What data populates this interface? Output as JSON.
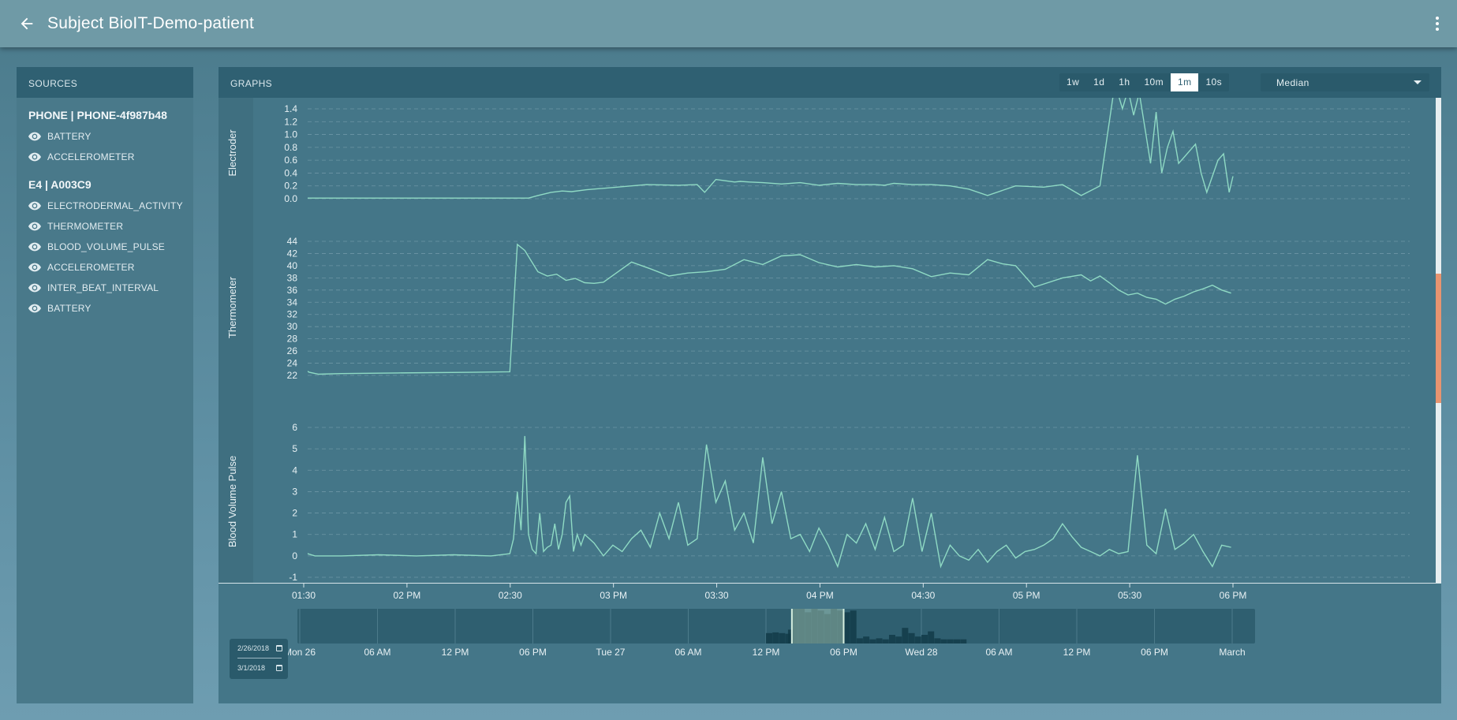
{
  "header": {
    "title": "Subject BioIT-Demo-patient",
    "back_icon": "arrow-left-icon",
    "menu_icon": "more-vertical-icon"
  },
  "sources": {
    "title": "SOURCES",
    "devices": [
      {
        "name": "PHONE | PHONE-4f987b48",
        "items": [
          "BATTERY",
          "ACCELEROMETER"
        ]
      },
      {
        "name": "E4 | A003C9",
        "items": [
          "ELECTRODERMAL_ACTIVITY",
          "THERMOMETER",
          "BLOOD_VOLUME_PULSE",
          "ACCELEROMETER",
          "INTER_BEAT_INTERVAL",
          "BATTERY"
        ]
      }
    ],
    "item_icon": "eye-icon"
  },
  "graphs": {
    "title": "GRAPHS",
    "ranges": [
      "1w",
      "1d",
      "1h",
      "10m",
      "1m",
      "10s"
    ],
    "active_range": "1m",
    "aggregation": "Median",
    "date_start": "2/26/2018",
    "date_end": "3/1/2018"
  },
  "colors": {
    "line": "#8fdac4",
    "scroll_thumb": "#e89470",
    "panel_header": "#2f6072"
  },
  "chart_data": [
    {
      "type": "line",
      "ylabel": "Electroder",
      "yticks": [
        0.0,
        0.2,
        0.4,
        0.6,
        0.8,
        1.0,
        1.2,
        1.4
      ],
      "ylim": [
        0.0,
        1.4
      ],
      "x_unit": "minutes since 01:30",
      "series": [
        {
          "x": [
            0,
            20,
            40,
            60,
            80,
            100,
            120,
            125,
            132,
            138,
            143,
            151,
            183,
            200,
            210,
            214,
            220,
            225,
            230,
            233,
            238,
            245,
            255,
            265,
            275,
            285,
            295,
            305,
            310,
            315,
            325,
            335,
            345,
            355,
            365,
            380,
            395,
            405,
            415,
            425,
            433,
            437,
            440,
            443,
            446,
            449,
            452,
            455,
            458,
            461,
            464,
            467,
            470,
            473,
            476,
            479,
            482,
            485,
            488,
            491,
            494,
            496
          ],
          "y": [
            0.01,
            0.01,
            0.01,
            0.01,
            0.01,
            0.01,
            0.01,
            0.05,
            0.1,
            0.12,
            0.11,
            0.14,
            0.22,
            0.21,
            0.22,
            0.1,
            0.3,
            0.28,
            0.26,
            0.27,
            0.26,
            0.25,
            0.23,
            0.25,
            0.21,
            0.24,
            0.22,
            0.22,
            0.21,
            0.24,
            0.22,
            0.22,
            0.2,
            0.15,
            0.05,
            0.2,
            0.18,
            0.22,
            0.05,
            0.2,
            1.8,
            1.4,
            1.7,
            1.3,
            1.65,
            1.1,
            0.55,
            1.35,
            0.4,
            0.8,
            1.05,
            0.55,
            0.65,
            0.75,
            0.85,
            0.4,
            0.1,
            0.35,
            0.6,
            0.7,
            0.1,
            0.35
          ]
        }
      ]
    },
    {
      "type": "line",
      "ylabel": "Thermometer",
      "yticks": [
        22,
        24,
        26,
        28,
        30,
        32,
        34,
        36,
        38,
        40,
        42,
        44
      ],
      "ylim": [
        22,
        44
      ],
      "x_unit": "minutes since 01:30",
      "series": [
        {
          "x": [
            0,
            3,
            8,
            20,
            50,
            90,
            110,
            114,
            118,
            121,
            125,
            130,
            135,
            140,
            145,
            150,
            155,
            160,
            175,
            185,
            195,
            205,
            215,
            225,
            235,
            245,
            255,
            265,
            275,
            285,
            295,
            305,
            315,
            325,
            335,
            345,
            355,
            365,
            373,
            380,
            390,
            405,
            415,
            420,
            425,
            430,
            435,
            440,
            445,
            450,
            455,
            460,
            465,
            470,
            475,
            480,
            485,
            490,
            495
          ],
          "y": [
            23.0,
            22.5,
            22.2,
            22.3,
            22.4,
            22.5,
            22.6,
            43.5,
            42.5,
            41.0,
            39.0,
            38.3,
            38.6,
            37.6,
            37.9,
            37.2,
            37.1,
            37.3,
            40.6,
            39.5,
            38.3,
            38.8,
            39.0,
            39.4,
            41.0,
            40.2,
            41.6,
            41.8,
            40.5,
            39.8,
            40.2,
            39.8,
            40.0,
            39.5,
            38.2,
            38.8,
            38.5,
            41.0,
            40.3,
            40.0,
            36.5,
            38.0,
            38.5,
            37.5,
            38.3,
            37.2,
            36.0,
            35.2,
            35.5,
            34.8,
            34.5,
            33.7,
            34.5,
            35.0,
            35.7,
            36.2,
            36.8,
            36.0,
            35.5
          ]
        }
      ]
    },
    {
      "type": "line",
      "ylabel": "Blood Volume Pulse",
      "yticks": [
        -1,
        0,
        1,
        2,
        3,
        4,
        5,
        6
      ],
      "ylim": [
        -1,
        6
      ],
      "x_unit": "minutes since 01:30",
      "series": [
        {
          "x": [
            0,
            2,
            6,
            20,
            40,
            60,
            80,
            100,
            110,
            112,
            114,
            116,
            118,
            120,
            122,
            124,
            126,
            128,
            130,
            132,
            134,
            136,
            138,
            140,
            142,
            144,
            146,
            148,
            150,
            155,
            160,
            165,
            170,
            175,
            180,
            185,
            190,
            195,
            200,
            205,
            210,
            215,
            220,
            225,
            230,
            235,
            240,
            245,
            250,
            255,
            260,
            265,
            270,
            275,
            280,
            285,
            290,
            295,
            300,
            305,
            310,
            315,
            320,
            325,
            330,
            335,
            340,
            345,
            350,
            355,
            360,
            365,
            370,
            375,
            380,
            385,
            390,
            395,
            400,
            405,
            410,
            415,
            420,
            425,
            430,
            435,
            440,
            445,
            450,
            455,
            460,
            465,
            470,
            475,
            480,
            485,
            490,
            495
          ],
          "y": [
            0.6,
            0.1,
            0.0,
            0.0,
            0.05,
            0.0,
            0.05,
            0.0,
            0.1,
            0.8,
            3.0,
            1.2,
            5.6,
            1.0,
            0.3,
            0.1,
            2.0,
            0.2,
            0.4,
            0.5,
            1.5,
            0.3,
            1.0,
            2.5,
            2.8,
            0.2,
            1.0,
            0.5,
            1.0,
            0.6,
            0.0,
            0.5,
            0.2,
            0.8,
            1.2,
            0.4,
            2.0,
            0.8,
            2.5,
            0.5,
            0.8,
            5.2,
            2.5,
            3.5,
            1.2,
            2.0,
            0.6,
            4.6,
            1.5,
            3.0,
            0.8,
            1.0,
            0.2,
            1.3,
            0.5,
            -0.5,
            1.0,
            0.6,
            1.5,
            0.3,
            1.8,
            0.2,
            0.5,
            2.7,
            0.2,
            2.0,
            -0.5,
            0.5,
            0.0,
            -0.2,
            0.3,
            -0.3,
            0.2,
            0.5,
            -0.1,
            0.2,
            0.3,
            0.5,
            0.8,
            1.5,
            0.9,
            0.4,
            0.2,
            0.0,
            0.3,
            0.1,
            0.2,
            4.7,
            0.5,
            0.1,
            2.2,
            0.3,
            0.6,
            1.0,
            0.2,
            -0.5,
            0.5,
            0.4
          ]
        }
      ]
    }
  ],
  "time_axis": {
    "ticks": [
      "01:30",
      "02 PM",
      "02:30",
      "03 PM",
      "03:30",
      "04 PM",
      "04:30",
      "05 PM",
      "05:30",
      "06 PM"
    ],
    "tick_minutes": [
      0,
      30,
      60,
      90,
      120,
      150,
      180,
      210,
      240,
      270
    ]
  },
  "navigator": {
    "ticks": [
      "Mon 26",
      "06 AM",
      "12 PM",
      "06 PM",
      "Tue 27",
      "06 AM",
      "12 PM",
      "06 PM",
      "Wed 28",
      "06 AM",
      "12 PM",
      "06 PM",
      "March"
    ],
    "tick_hours": [
      0,
      6,
      12,
      18,
      24,
      30,
      36,
      42,
      48,
      54,
      60,
      66,
      72
    ],
    "bars": [
      {
        "h": 36.0,
        "v": 0.3
      },
      {
        "h": 36.5,
        "v": 0.32
      },
      {
        "h": 37.0,
        "v": 0.3
      },
      {
        "h": 37.5,
        "v": 0.28
      },
      {
        "h": 37.7,
        "v": 0.4
      },
      {
        "h": 38.0,
        "v": 1.0
      },
      {
        "h": 38.5,
        "v": 1.0
      },
      {
        "h": 39.0,
        "v": 0.9
      },
      {
        "h": 39.5,
        "v": 1.0
      },
      {
        "h": 40.0,
        "v": 0.95
      },
      {
        "h": 40.5,
        "v": 0.85
      },
      {
        "h": 41.0,
        "v": 1.0
      },
      {
        "h": 41.5,
        "v": 0.95
      },
      {
        "h": 42.0,
        "v": 0.9
      },
      {
        "h": 42.5,
        "v": 0.95
      },
      {
        "h": 43.0,
        "v": 0.15
      },
      {
        "h": 43.5,
        "v": 0.2
      },
      {
        "h": 44.0,
        "v": 0.12
      },
      {
        "h": 44.5,
        "v": 0.15
      },
      {
        "h": 45.0,
        "v": 0.12
      },
      {
        "h": 45.5,
        "v": 0.25
      },
      {
        "h": 46.0,
        "v": 0.2
      },
      {
        "h": 46.5,
        "v": 0.45
      },
      {
        "h": 47.0,
        "v": 0.3
      },
      {
        "h": 47.5,
        "v": 0.2
      },
      {
        "h": 48.0,
        "v": 0.25
      },
      {
        "h": 48.5,
        "v": 0.35
      },
      {
        "h": 49.0,
        "v": 0.15
      },
      {
        "h": 49.5,
        "v": 0.12
      },
      {
        "h": 50.0,
        "v": 0.12
      },
      {
        "h": 50.5,
        "v": 0.12
      },
      {
        "h": 51.0,
        "v": 0.12
      }
    ],
    "selection_hours": [
      38.0,
      42.0
    ]
  }
}
